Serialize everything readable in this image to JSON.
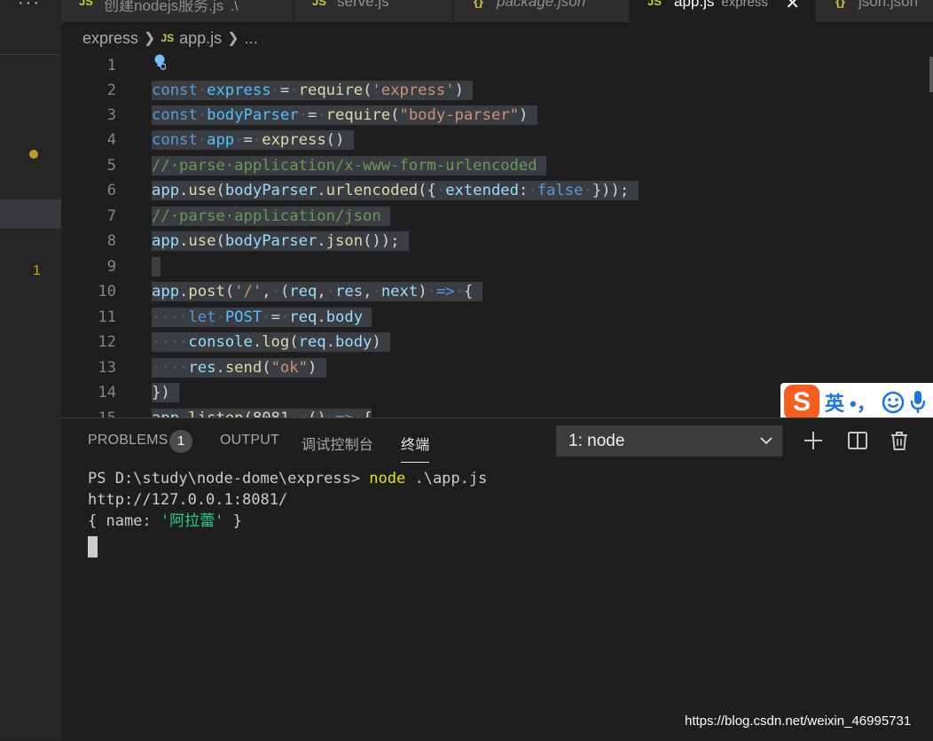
{
  "sidebar": {
    "more_label": "···",
    "problem_count": "1"
  },
  "tabs": [
    {
      "badge": "JS",
      "label": "创建nodejs服务.js",
      "desc": ".\\"
    },
    {
      "badge": "JS",
      "label": "serve.js"
    },
    {
      "badge": "{}",
      "label": "package.json"
    },
    {
      "badge": "JS",
      "label": "app.js",
      "desc": "express",
      "close": "✕"
    },
    {
      "badge": "{}",
      "label": "json.json"
    }
  ],
  "breadcrumb": {
    "folder": "express",
    "file_badge": "JS",
    "file": "app.js",
    "more": "..."
  },
  "editor": {
    "line_numbers": [
      "1",
      "2",
      "3",
      "4",
      "5",
      "6",
      "7",
      "8",
      "9",
      "10",
      "11",
      "12",
      "13",
      "14",
      "15"
    ]
  },
  "ime": {
    "logo": "S",
    "mode": "英",
    "punct": "•，"
  },
  "panel": {
    "tabs": [
      "PROBLEMS",
      "OUTPUT",
      "调试控制台",
      "终端"
    ],
    "problems_badge": "1",
    "terminal_selector": "1: node"
  },
  "terminal": {
    "prompt": "PS D:\\study\\node-dome\\express> ",
    "command": "node",
    "args": " .\\app.js",
    "line2": "http://127.0.0.1:8081/",
    "line3_open": "{ name: ",
    "line3_value": "'阿拉蕾'",
    "line3_close": " }"
  },
  "watermark": "https://blog.csdn.net/weixin_46995731",
  "colors": {
    "editor_bg": "#1e1e1e",
    "sidebar_bg": "#252526",
    "tab_inactive_bg": "#2d2d2d",
    "selection_bg": "#3a3d41",
    "keyword": "#569cd6",
    "string": "#ce9178",
    "comment": "#6a9955",
    "function": "#dcdcaa",
    "identifier": "#9cdcfe",
    "terminal_command": "#e5e510",
    "terminal_string": "#23d18b",
    "ime_brand": "#f85d20"
  }
}
